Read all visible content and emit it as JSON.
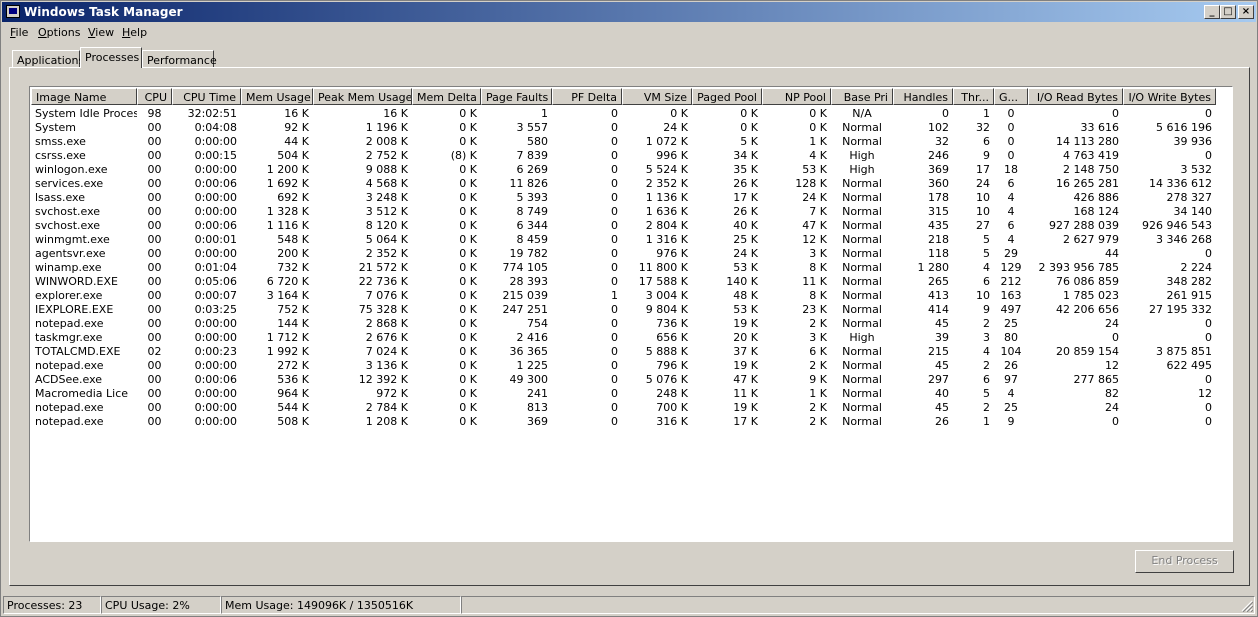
{
  "window": {
    "title": "Windows Task Manager"
  },
  "controls": {
    "minimize": "_",
    "maximize": "□",
    "close": "×"
  },
  "menu": [
    {
      "label": "File",
      "mnemonic": "F",
      "rest": "ile"
    },
    {
      "label": "Options",
      "mnemonic": "O",
      "rest": "ptions"
    },
    {
      "label": "View",
      "mnemonic": "V",
      "rest": "iew"
    },
    {
      "label": "Help",
      "mnemonic": "H",
      "rest": "elp"
    }
  ],
  "tabs": [
    {
      "label": "Applications",
      "active": false
    },
    {
      "label": "Processes",
      "active": true
    },
    {
      "label": "Performance",
      "active": false
    }
  ],
  "columns": [
    "Image Name",
    "CPU",
    "CPU Time",
    "Mem Usage",
    "Peak Mem Usage",
    "Mem Delta",
    "Page Faults",
    "PF Delta",
    "VM Size",
    "Paged Pool",
    "NP Pool",
    "Base Pri",
    "Handles",
    "Thr...",
    "G...",
    "I/O Read Bytes",
    "I/O Write Bytes"
  ],
  "rows": [
    [
      "System Idle Process",
      "98",
      "32:02:51",
      "16 K",
      "16 K",
      "0 K",
      "1",
      "0",
      "0 K",
      "0 K",
      "0 K",
      "N/A",
      "0",
      "1",
      "0",
      "0",
      "0"
    ],
    [
      "System",
      "00",
      "0:04:08",
      "92 K",
      "1 196 K",
      "0 K",
      "3 557",
      "0",
      "24 K",
      "0 K",
      "0 K",
      "Normal",
      "102",
      "32",
      "0",
      "33 616",
      "5 616 196"
    ],
    [
      "smss.exe",
      "00",
      "0:00:00",
      "44 K",
      "2 008 K",
      "0 K",
      "580",
      "0",
      "1 072 K",
      "5 K",
      "1 K",
      "Normal",
      "32",
      "6",
      "0",
      "14 113 280",
      "39 936"
    ],
    [
      "csrss.exe",
      "00",
      "0:00:15",
      "504 K",
      "2 752 K",
      "(8) K",
      "7 839",
      "0",
      "996 K",
      "34 K",
      "4 K",
      "High",
      "246",
      "9",
      "0",
      "4 763 419",
      "0"
    ],
    [
      "winlogon.exe",
      "00",
      "0:00:00",
      "1 200 K",
      "9 088 K",
      "0 K",
      "6 269",
      "0",
      "5 524 K",
      "35 K",
      "53 K",
      "High",
      "369",
      "17",
      "18",
      "2 148 750",
      "3 532"
    ],
    [
      "services.exe",
      "00",
      "0:00:06",
      "1 692 K",
      "4 568 K",
      "0 K",
      "11 826",
      "0",
      "2 352 K",
      "26 K",
      "128 K",
      "Normal",
      "360",
      "24",
      "6",
      "16 265 281",
      "14 336 612"
    ],
    [
      "lsass.exe",
      "00",
      "0:00:00",
      "692 K",
      "3 248 K",
      "0 K",
      "5 393",
      "0",
      "1 136 K",
      "17 K",
      "24 K",
      "Normal",
      "178",
      "10",
      "4",
      "426 886",
      "278 327"
    ],
    [
      "svchost.exe",
      "00",
      "0:00:00",
      "1 328 K",
      "3 512 K",
      "0 K",
      "8 749",
      "0",
      "1 636 K",
      "26 K",
      "7 K",
      "Normal",
      "315",
      "10",
      "4",
      "168 124",
      "34 140"
    ],
    [
      "svchost.exe",
      "00",
      "0:00:06",
      "1 116 K",
      "8 120 K",
      "0 K",
      "6 344",
      "0",
      "2 804 K",
      "40 K",
      "47 K",
      "Normal",
      "435",
      "27",
      "6",
      "927 288 039",
      "926 946 543"
    ],
    [
      "winmgmt.exe",
      "00",
      "0:00:01",
      "548 K",
      "5 064 K",
      "0 K",
      "8 459",
      "0",
      "1 316 K",
      "25 K",
      "12 K",
      "Normal",
      "218",
      "5",
      "4",
      "2 627 979",
      "3 346 268"
    ],
    [
      "agentsvr.exe",
      "00",
      "0:00:00",
      "200 K",
      "2 352 K",
      "0 K",
      "19 782",
      "0",
      "976 K",
      "24 K",
      "3 K",
      "Normal",
      "118",
      "5",
      "29",
      "44",
      "0"
    ],
    [
      "winamp.exe",
      "00",
      "0:01:04",
      "732 K",
      "21 572 K",
      "0 K",
      "774 105",
      "0",
      "11 800 K",
      "53 K",
      "8 K",
      "Normal",
      "1 280",
      "4",
      "129",
      "2 393 956 785",
      "2 224"
    ],
    [
      "WINWORD.EXE",
      "00",
      "0:05:06",
      "6 720 K",
      "22 736 K",
      "0 K",
      "28 393",
      "0",
      "17 588 K",
      "140 K",
      "11 K",
      "Normal",
      "265",
      "6",
      "212",
      "76 086 859",
      "348 282"
    ],
    [
      "explorer.exe",
      "00",
      "0:00:07",
      "3 164 K",
      "7 076 K",
      "0 K",
      "215 039",
      "1",
      "3 004 K",
      "48 K",
      "8 K",
      "Normal",
      "413",
      "10",
      "163",
      "1 785 023",
      "261 915"
    ],
    [
      "IEXPLORE.EXE",
      "00",
      "0:03:25",
      "752 K",
      "75 328 K",
      "0 K",
      "247 251",
      "0",
      "9 804 K",
      "53 K",
      "23 K",
      "Normal",
      "414",
      "9",
      "497",
      "42 206 656",
      "27 195 332"
    ],
    [
      "notepad.exe",
      "00",
      "0:00:00",
      "144 K",
      "2 868 K",
      "0 K",
      "754",
      "0",
      "736 K",
      "19 K",
      "2 K",
      "Normal",
      "45",
      "2",
      "25",
      "24",
      "0"
    ],
    [
      "taskmgr.exe",
      "00",
      "0:00:00",
      "1 712 K",
      "2 676 K",
      "0 K",
      "2 416",
      "0",
      "656 K",
      "20 K",
      "3 K",
      "High",
      "39",
      "3",
      "80",
      "0",
      "0"
    ],
    [
      "TOTALCMD.EXE",
      "02",
      "0:00:23",
      "1 992 K",
      "7 024 K",
      "0 K",
      "36 365",
      "0",
      "5 888 K",
      "37 K",
      "6 K",
      "Normal",
      "215",
      "4",
      "104",
      "20 859 154",
      "3 875 851"
    ],
    [
      "notepad.exe",
      "00",
      "0:00:00",
      "272 K",
      "3 136 K",
      "0 K",
      "1 225",
      "0",
      "796 K",
      "19 K",
      "2 K",
      "Normal",
      "45",
      "2",
      "26",
      "12",
      "622 495"
    ],
    [
      "ACDSee.exe",
      "00",
      "0:00:06",
      "536 K",
      "12 392 K",
      "0 K",
      "49 300",
      "0",
      "5 076 K",
      "47 K",
      "9 K",
      "Normal",
      "297",
      "6",
      "97",
      "277 865",
      "0"
    ],
    [
      "Macromedia Lice",
      "00",
      "0:00:00",
      "964 K",
      "972 K",
      "0 K",
      "241",
      "0",
      "248 K",
      "11 K",
      "1 K",
      "Normal",
      "40",
      "5",
      "4",
      "82",
      "12"
    ],
    [
      "notepad.exe",
      "00",
      "0:00:00",
      "544 K",
      "2 784 K",
      "0 K",
      "813",
      "0",
      "700 K",
      "19 K",
      "2 K",
      "Normal",
      "45",
      "2",
      "25",
      "24",
      "0"
    ],
    [
      "notepad.exe",
      "00",
      "0:00:00",
      "508 K",
      "1 208 K",
      "0 K",
      "369",
      "0",
      "316 K",
      "17 K",
      "2 K",
      "Normal",
      "26",
      "1",
      "9",
      "0",
      "0"
    ]
  ],
  "end_process_label": "End Process",
  "status": {
    "processes": "Processes: 23",
    "cpu": "CPU Usage: 2%",
    "mem": "Mem Usage: 149096K / 1350516K"
  }
}
